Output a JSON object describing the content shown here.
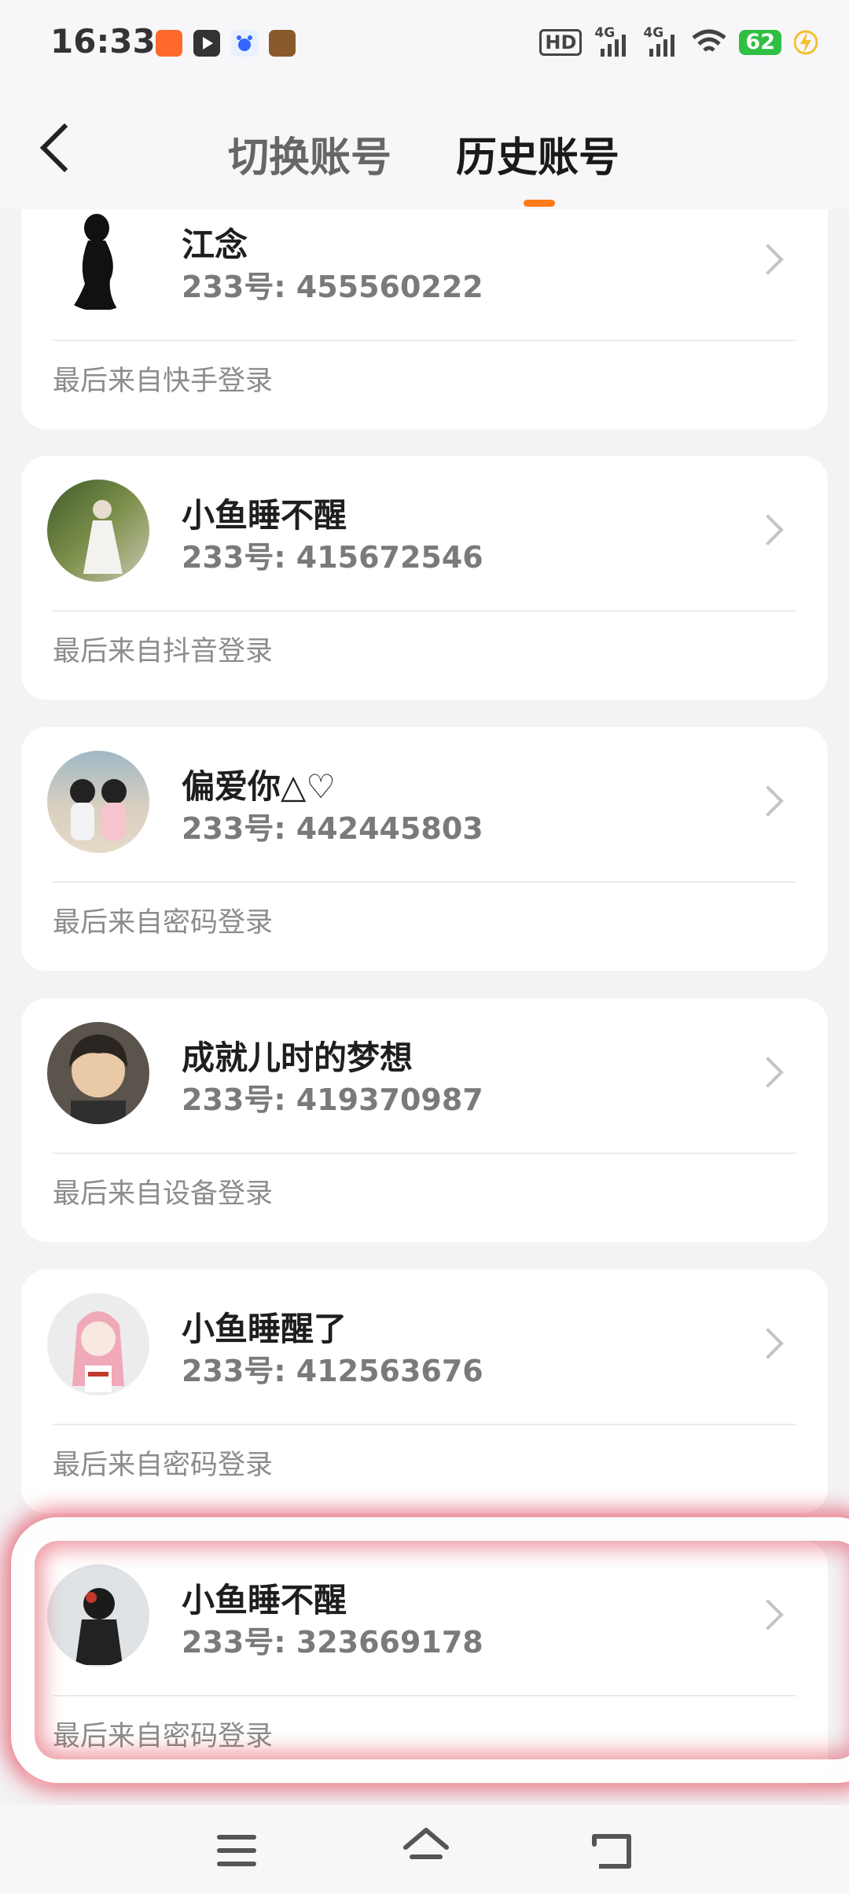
{
  "status_bar": {
    "time": "16:33",
    "hd_label": "HD",
    "network_1": "4G",
    "network_2": "4G",
    "battery": "62",
    "app_icons": [
      "kuaishou-app-icon",
      "video-app-icon",
      "baidu-app-icon",
      "game-app-icon"
    ]
  },
  "header": {
    "tabs": [
      {
        "label": "切换账号",
        "active": false
      },
      {
        "label": "历史账号",
        "active": true
      }
    ],
    "accent_color": "#ff7a1a"
  },
  "accounts": [
    {
      "name": "江念",
      "id_text": "233号: 455560222",
      "source": "最后来自快手登录",
      "avatar": "silhouette-avatar"
    },
    {
      "name": "小鱼睡不醒",
      "id_text": "233号: 415672546",
      "source": "最后来自抖音登录",
      "avatar": "bride-photo-avatar"
    },
    {
      "name": "偏爱你△♡",
      "id_text": "233号: 442445803",
      "source": "最后来自密码登录",
      "avatar": "two-girls-photo-avatar"
    },
    {
      "name": "成就儿时的梦想",
      "id_text": "233号: 419370987",
      "source": "最后来自设备登录",
      "avatar": "anime-boy-avatar"
    },
    {
      "name": "小鱼睡醒了",
      "id_text": "233号: 412563676",
      "source": "最后来自密码登录",
      "avatar": "anime-pink-hair-girl-avatar"
    },
    {
      "name": "小鱼睡不醒",
      "id_text": "233号: 323669178",
      "source": "最后来自密码登录",
      "avatar": "anime-dark-figure-avatar"
    }
  ],
  "nav_bar": {
    "items": [
      "menu-icon",
      "home-icon",
      "back-icon"
    ]
  }
}
